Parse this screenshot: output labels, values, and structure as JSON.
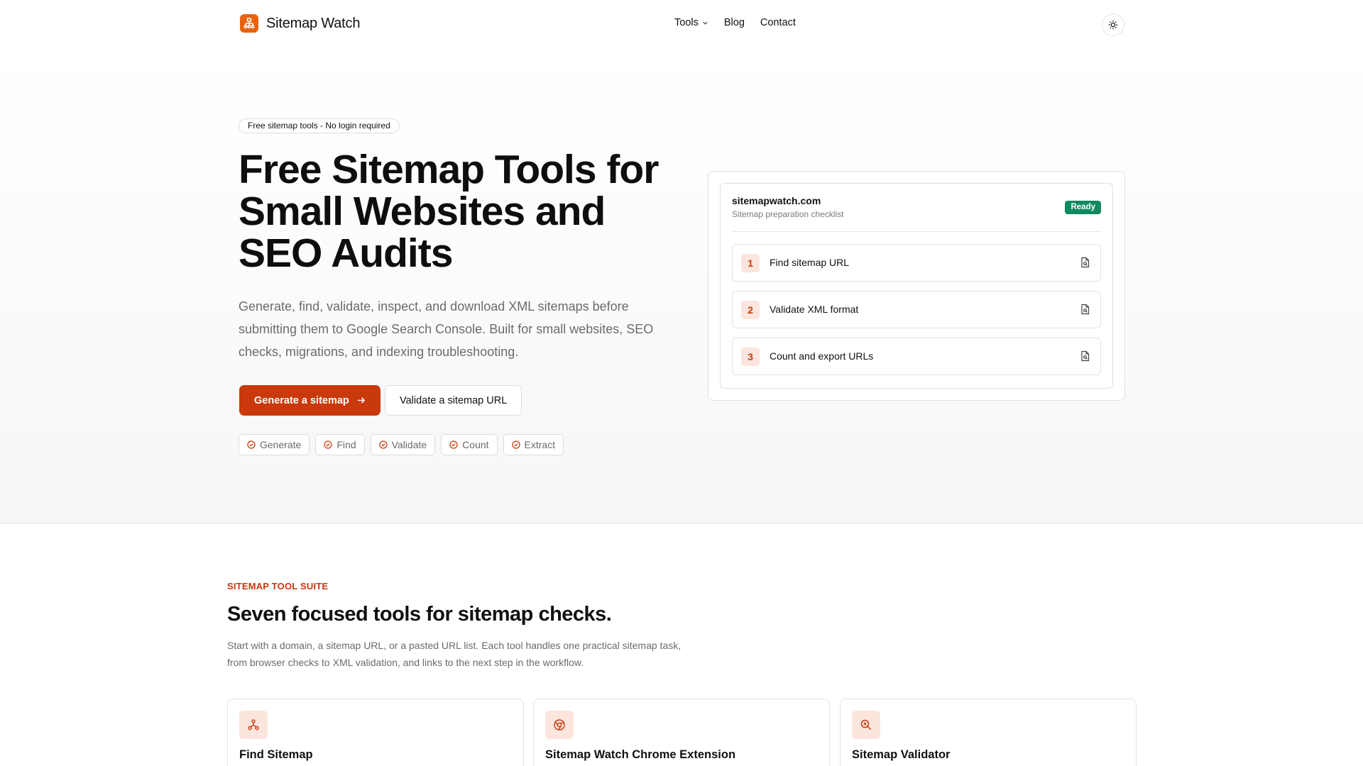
{
  "header": {
    "brand_name": "Sitemap Watch",
    "nav": [
      {
        "label": "Tools",
        "has_dropdown": true
      },
      {
        "label": "Blog"
      },
      {
        "label": "Contact"
      }
    ],
    "theme_toggle_icon": "sun-icon"
  },
  "hero": {
    "pill": "Free sitemap tools - No login required",
    "title": "Free Sitemap Tools for Small Websites and SEO Audits",
    "description": "Generate, find, validate, inspect, and download XML sitemaps before submitting them to Google Search Console. Built for small websites, SEO checks, migrations, and indexing troubleshooting.",
    "primary_cta": "Generate a sitemap",
    "secondary_cta": "Validate a sitemap URL",
    "chips": [
      "Generate",
      "Find",
      "Validate",
      "Count",
      "Extract"
    ]
  },
  "checklist": {
    "domain": "sitemapwatch.com",
    "subtitle": "Sitemap preparation checklist",
    "status": "Ready",
    "steps": [
      {
        "num": "1",
        "label": "Find sitemap URL"
      },
      {
        "num": "2",
        "label": "Validate XML format"
      },
      {
        "num": "3",
        "label": "Count and export URLs"
      }
    ]
  },
  "tools_section": {
    "eyebrow": "SITEMAP TOOL SUITE",
    "title": "Seven focused tools for sitemap checks.",
    "description": "Start with a domain, a sitemap URL, or a pasted URL list. Each tool handles one practical sitemap task, from browser checks to XML validation, and links to the next step in the workflow.",
    "cards": [
      {
        "name": "Find Sitemap",
        "icon": "sitemap-icon"
      },
      {
        "name": "Sitemap Watch Chrome Extension",
        "icon": "chrome-icon"
      },
      {
        "name": "Sitemap Validator",
        "icon": "search-icon"
      }
    ]
  },
  "colors": {
    "accent": "#c8390b",
    "logo": "#e8620f",
    "success": "#0e8a5f",
    "accent_soft": "#fbe5dc"
  }
}
